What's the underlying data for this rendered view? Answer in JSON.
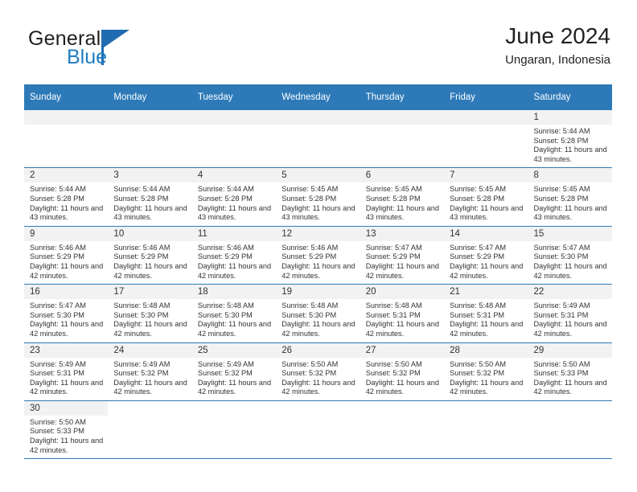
{
  "brand": {
    "name_part1": "General",
    "name_part2": "Blue",
    "triangle_color": "#1f6cb0"
  },
  "header": {
    "title": "June 2024",
    "subtitle": "Ungaran, Indonesia"
  },
  "theme": {
    "header_blue": "#2e7ab8",
    "band_gray": "#f2f2f2",
    "text": "#333333"
  },
  "calendar": {
    "weekday_headers": [
      "Sunday",
      "Monday",
      "Tuesday",
      "Wednesday",
      "Thursday",
      "Friday",
      "Saturday"
    ],
    "labels": {
      "sunrise": "Sunrise:",
      "sunset": "Sunset:",
      "daylight": "Daylight:"
    },
    "weeks": [
      [
        {
          "day": "",
          "empty": true
        },
        {
          "day": "",
          "empty": true
        },
        {
          "day": "",
          "empty": true
        },
        {
          "day": "",
          "empty": true
        },
        {
          "day": "",
          "empty": true
        },
        {
          "day": "",
          "empty": true
        },
        {
          "day": "1",
          "sunrise": "Sunrise: 5:44 AM",
          "sunset": "Sunset: 5:28 PM",
          "daylight": "Daylight: 11 hours and 43 minutes."
        }
      ],
      [
        {
          "day": "2",
          "sunrise": "Sunrise: 5:44 AM",
          "sunset": "Sunset: 5:28 PM",
          "daylight": "Daylight: 11 hours and 43 minutes."
        },
        {
          "day": "3",
          "sunrise": "Sunrise: 5:44 AM",
          "sunset": "Sunset: 5:28 PM",
          "daylight": "Daylight: 11 hours and 43 minutes."
        },
        {
          "day": "4",
          "sunrise": "Sunrise: 5:44 AM",
          "sunset": "Sunset: 5:28 PM",
          "daylight": "Daylight: 11 hours and 43 minutes."
        },
        {
          "day": "5",
          "sunrise": "Sunrise: 5:45 AM",
          "sunset": "Sunset: 5:28 PM",
          "daylight": "Daylight: 11 hours and 43 minutes."
        },
        {
          "day": "6",
          "sunrise": "Sunrise: 5:45 AM",
          "sunset": "Sunset: 5:28 PM",
          "daylight": "Daylight: 11 hours and 43 minutes."
        },
        {
          "day": "7",
          "sunrise": "Sunrise: 5:45 AM",
          "sunset": "Sunset: 5:28 PM",
          "daylight": "Daylight: 11 hours and 43 minutes."
        },
        {
          "day": "8",
          "sunrise": "Sunrise: 5:45 AM",
          "sunset": "Sunset: 5:28 PM",
          "daylight": "Daylight: 11 hours and 43 minutes."
        }
      ],
      [
        {
          "day": "9",
          "sunrise": "Sunrise: 5:46 AM",
          "sunset": "Sunset: 5:29 PM",
          "daylight": "Daylight: 11 hours and 42 minutes."
        },
        {
          "day": "10",
          "sunrise": "Sunrise: 5:46 AM",
          "sunset": "Sunset: 5:29 PM",
          "daylight": "Daylight: 11 hours and 42 minutes."
        },
        {
          "day": "11",
          "sunrise": "Sunrise: 5:46 AM",
          "sunset": "Sunset: 5:29 PM",
          "daylight": "Daylight: 11 hours and 42 minutes."
        },
        {
          "day": "12",
          "sunrise": "Sunrise: 5:46 AM",
          "sunset": "Sunset: 5:29 PM",
          "daylight": "Daylight: 11 hours and 42 minutes."
        },
        {
          "day": "13",
          "sunrise": "Sunrise: 5:47 AM",
          "sunset": "Sunset: 5:29 PM",
          "daylight": "Daylight: 11 hours and 42 minutes."
        },
        {
          "day": "14",
          "sunrise": "Sunrise: 5:47 AM",
          "sunset": "Sunset: 5:29 PM",
          "daylight": "Daylight: 11 hours and 42 minutes."
        },
        {
          "day": "15",
          "sunrise": "Sunrise: 5:47 AM",
          "sunset": "Sunset: 5:30 PM",
          "daylight": "Daylight: 11 hours and 42 minutes."
        }
      ],
      [
        {
          "day": "16",
          "sunrise": "Sunrise: 5:47 AM",
          "sunset": "Sunset: 5:30 PM",
          "daylight": "Daylight: 11 hours and 42 minutes."
        },
        {
          "day": "17",
          "sunrise": "Sunrise: 5:48 AM",
          "sunset": "Sunset: 5:30 PM",
          "daylight": "Daylight: 11 hours and 42 minutes."
        },
        {
          "day": "18",
          "sunrise": "Sunrise: 5:48 AM",
          "sunset": "Sunset: 5:30 PM",
          "daylight": "Daylight: 11 hours and 42 minutes."
        },
        {
          "day": "19",
          "sunrise": "Sunrise: 5:48 AM",
          "sunset": "Sunset: 5:30 PM",
          "daylight": "Daylight: 11 hours and 42 minutes."
        },
        {
          "day": "20",
          "sunrise": "Sunrise: 5:48 AM",
          "sunset": "Sunset: 5:31 PM",
          "daylight": "Daylight: 11 hours and 42 minutes."
        },
        {
          "day": "21",
          "sunrise": "Sunrise: 5:48 AM",
          "sunset": "Sunset: 5:31 PM",
          "daylight": "Daylight: 11 hours and 42 minutes."
        },
        {
          "day": "22",
          "sunrise": "Sunrise: 5:49 AM",
          "sunset": "Sunset: 5:31 PM",
          "daylight": "Daylight: 11 hours and 42 minutes."
        }
      ],
      [
        {
          "day": "23",
          "sunrise": "Sunrise: 5:49 AM",
          "sunset": "Sunset: 5:31 PM",
          "daylight": "Daylight: 11 hours and 42 minutes."
        },
        {
          "day": "24",
          "sunrise": "Sunrise: 5:49 AM",
          "sunset": "Sunset: 5:32 PM",
          "daylight": "Daylight: 11 hours and 42 minutes."
        },
        {
          "day": "25",
          "sunrise": "Sunrise: 5:49 AM",
          "sunset": "Sunset: 5:32 PM",
          "daylight": "Daylight: 11 hours and 42 minutes."
        },
        {
          "day": "26",
          "sunrise": "Sunrise: 5:50 AM",
          "sunset": "Sunset: 5:32 PM",
          "daylight": "Daylight: 11 hours and 42 minutes."
        },
        {
          "day": "27",
          "sunrise": "Sunrise: 5:50 AM",
          "sunset": "Sunset: 5:32 PM",
          "daylight": "Daylight: 11 hours and 42 minutes."
        },
        {
          "day": "28",
          "sunrise": "Sunrise: 5:50 AM",
          "sunset": "Sunset: 5:32 PM",
          "daylight": "Daylight: 11 hours and 42 minutes."
        },
        {
          "day": "29",
          "sunrise": "Sunrise: 5:50 AM",
          "sunset": "Sunset: 5:33 PM",
          "daylight": "Daylight: 11 hours and 42 minutes."
        }
      ],
      [
        {
          "day": "30",
          "sunrise": "Sunrise: 5:50 AM",
          "sunset": "Sunset: 5:33 PM",
          "daylight": "Daylight: 11 hours and 42 minutes."
        },
        {
          "day": "",
          "empty": true,
          "blank": true
        },
        {
          "day": "",
          "empty": true,
          "blank": true
        },
        {
          "day": "",
          "empty": true,
          "blank": true
        },
        {
          "day": "",
          "empty": true,
          "blank": true
        },
        {
          "day": "",
          "empty": true,
          "blank": true
        },
        {
          "day": "",
          "empty": true,
          "blank": true
        }
      ]
    ]
  }
}
